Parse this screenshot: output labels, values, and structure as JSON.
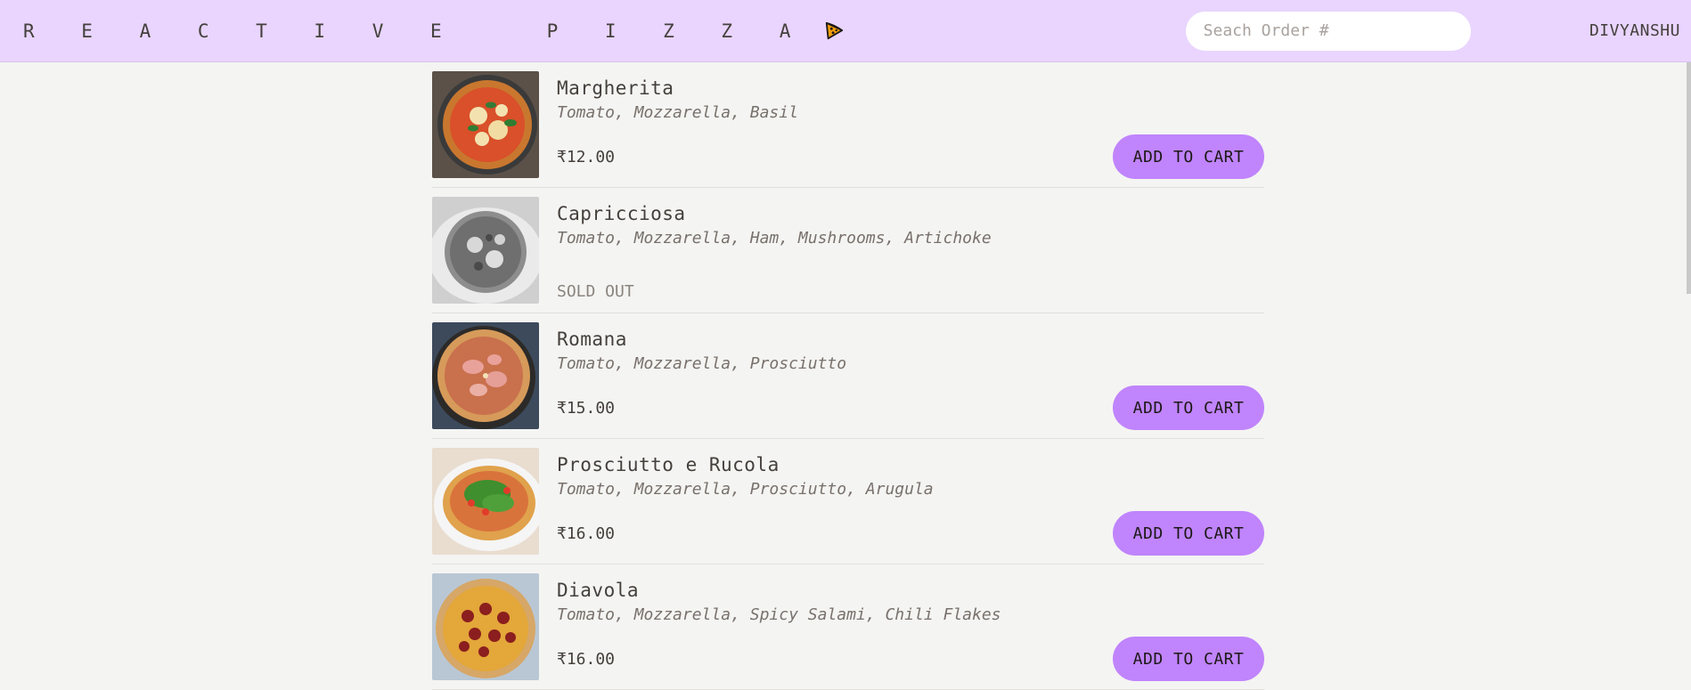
{
  "header": {
    "brand": "R E A C T I V E   P I Z Z A",
    "search_placeholder": "Seach Order #",
    "username": "DIVYANSHU"
  },
  "menu": {
    "items": [
      {
        "name": "Margherita",
        "ingredients": "Tomato, Mozzarella, Basil",
        "price": "₹12.00",
        "button": "ADD TO CART",
        "sold_out": false
      },
      {
        "name": "Capricciosa",
        "ingredients": "Tomato, Mozzarella, Ham, Mushrooms, Artichoke",
        "status": "SOLD OUT",
        "sold_out": true
      },
      {
        "name": "Romana",
        "ingredients": "Tomato, Mozzarella, Prosciutto",
        "price": "₹15.00",
        "button": "ADD TO CART",
        "sold_out": false
      },
      {
        "name": "Prosciutto e Rucola",
        "ingredients": "Tomato, Mozzarella, Prosciutto, Arugula",
        "price": "₹16.00",
        "button": "ADD TO CART",
        "sold_out": false
      },
      {
        "name": "Diavola",
        "ingredients": "Tomato, Mozzarella, Spicy Salami, Chili Flakes",
        "price": "₹16.00",
        "button": "ADD TO CART",
        "sold_out": false
      }
    ]
  },
  "colors": {
    "header_bg": "#e9d5ff",
    "button_bg": "#c084fc",
    "page_bg": "#f4f4f2"
  }
}
